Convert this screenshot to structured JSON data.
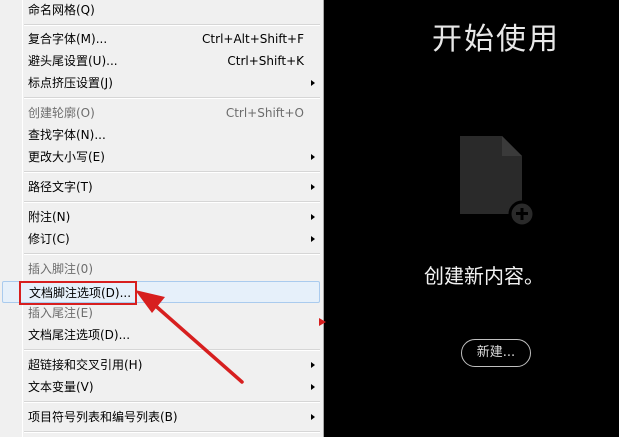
{
  "menu": {
    "items": [
      {
        "label": "命名网格(Q)",
        "shortcut": "",
        "submenu": false,
        "disabled": false
      },
      {
        "label": "复合字体(M)...",
        "shortcut": "Ctrl+Alt+Shift+F",
        "submenu": false,
        "disabled": false
      },
      {
        "label": "避头尾设置(U)...",
        "shortcut": "Ctrl+Shift+K",
        "submenu": false,
        "disabled": false
      },
      {
        "label": "标点挤压设置(J)",
        "shortcut": "",
        "submenu": true,
        "disabled": false
      },
      {
        "label": "创建轮廓(O)",
        "shortcut": "Ctrl+Shift+O",
        "submenu": false,
        "disabled": true
      },
      {
        "label": "查找字体(N)...",
        "shortcut": "",
        "submenu": false,
        "disabled": false
      },
      {
        "label": "更改大小写(E)",
        "shortcut": "",
        "submenu": true,
        "disabled": false
      },
      {
        "label": "路径文字(T)",
        "shortcut": "",
        "submenu": true,
        "disabled": false
      },
      {
        "label": "附注(N)",
        "shortcut": "",
        "submenu": true,
        "disabled": false
      },
      {
        "label": "修订(C)",
        "shortcut": "",
        "submenu": true,
        "disabled": false
      },
      {
        "label": "插入脚注(0)",
        "shortcut": "",
        "submenu": false,
        "disabled": true
      },
      {
        "label": "文档脚注选项(D)...",
        "shortcut": "",
        "submenu": false,
        "disabled": false
      },
      {
        "label": "插入尾注(E)",
        "shortcut": "",
        "submenu": false,
        "disabled": true
      },
      {
        "label": "文档尾注选项(D)...",
        "shortcut": "",
        "submenu": false,
        "disabled": false
      },
      {
        "label": "超链接和交叉引用(H)",
        "shortcut": "",
        "submenu": true,
        "disabled": false
      },
      {
        "label": "文本变量(V)",
        "shortcut": "",
        "submenu": true,
        "disabled": false
      },
      {
        "label": "项目符号列表和编号列表(B)",
        "shortcut": "",
        "submenu": true,
        "disabled": false
      }
    ]
  },
  "start": {
    "title": "开始使用",
    "create_text": "创建新内容。",
    "new_button": "新建..."
  },
  "colors": {
    "annotation": "#d71f1f",
    "menu_bg": "#f0f0f0",
    "panel_bg": "#000000"
  },
  "icons": {
    "document": "document-add-icon",
    "submenu": "submenu-arrow-icon"
  }
}
